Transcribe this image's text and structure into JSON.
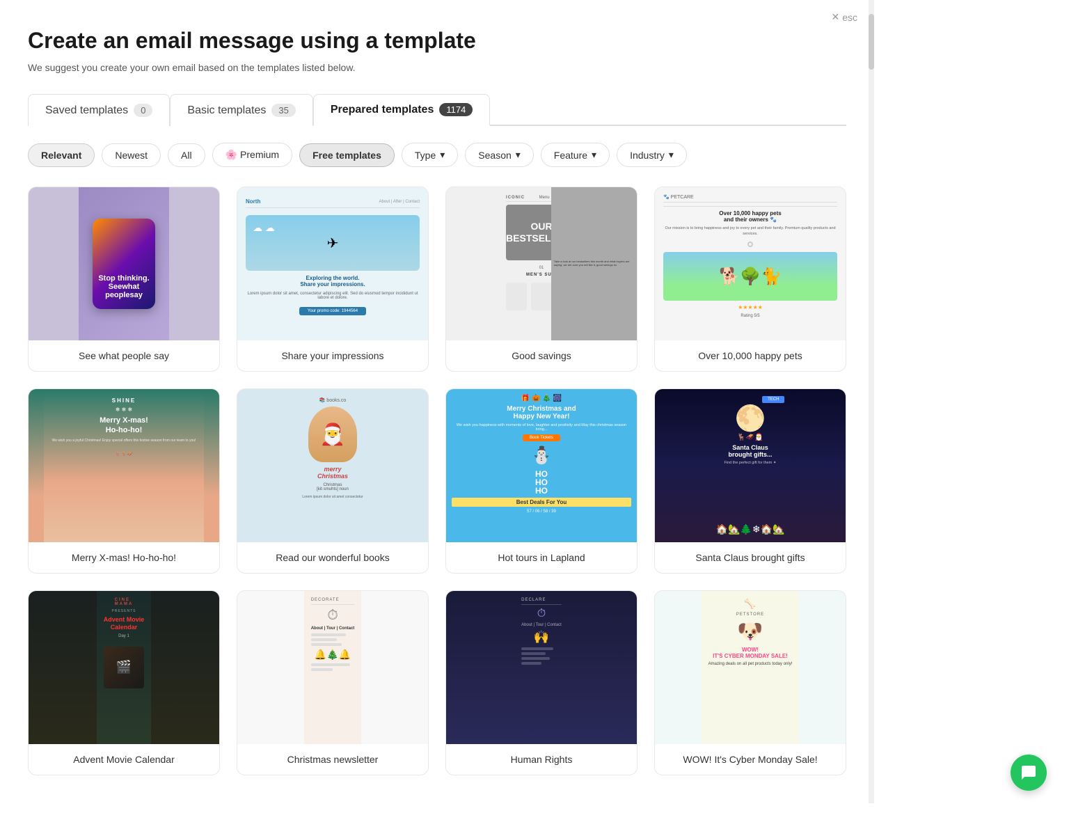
{
  "header": {
    "title": "Create an email message using a template",
    "subtitle": "We suggest you create your own email based on the templates listed below.",
    "esc_label": "esc"
  },
  "tabs": [
    {
      "id": "saved",
      "label": "Saved templates",
      "count": "0",
      "active": false
    },
    {
      "id": "basic",
      "label": "Basic templates",
      "count": "35",
      "active": false
    },
    {
      "id": "prepared",
      "label": "Prepared templates",
      "count": "1174",
      "active": true
    }
  ],
  "filters": [
    {
      "id": "relevant",
      "label": "Relevant",
      "active": true,
      "hasDropdown": false,
      "hasPremium": false
    },
    {
      "id": "newest",
      "label": "Newest",
      "active": false,
      "hasDropdown": false,
      "hasPremium": false
    },
    {
      "id": "all",
      "label": "All",
      "active": false,
      "hasDropdown": false,
      "hasPremium": false
    },
    {
      "id": "premium",
      "label": "Premium",
      "active": false,
      "hasDropdown": false,
      "hasPremium": true
    },
    {
      "id": "free",
      "label": "Free templates",
      "active": true,
      "hasDropdown": false,
      "hasPremium": false
    },
    {
      "id": "type",
      "label": "Type",
      "active": false,
      "hasDropdown": true,
      "hasPremium": false
    },
    {
      "id": "season",
      "label": "Season",
      "active": false,
      "hasDropdown": true,
      "hasPremium": false
    },
    {
      "id": "feature",
      "label": "Feature",
      "active": false,
      "hasDropdown": true,
      "hasPremium": false
    },
    {
      "id": "industry",
      "label": "Industry",
      "active": false,
      "hasDropdown": true,
      "hasPremium": false
    }
  ],
  "templates": [
    {
      "id": 1,
      "label": "See what people say"
    },
    {
      "id": 2,
      "label": "Share your impressions"
    },
    {
      "id": 3,
      "label": "Good savings"
    },
    {
      "id": 4,
      "label": "Over 10,000 happy pets"
    },
    {
      "id": 5,
      "label": "Merry X-mas! Ho-ho-ho!"
    },
    {
      "id": 6,
      "label": "Read our wonderful books"
    },
    {
      "id": 7,
      "label": "Hot tours in Lapland"
    },
    {
      "id": 8,
      "label": "Santa Claus brought gifts"
    },
    {
      "id": 9,
      "label": "Advent Movie Calendar"
    },
    {
      "id": 10,
      "label": "Christmas newsletter"
    },
    {
      "id": 11,
      "label": "Human Rights"
    },
    {
      "id": 12,
      "label": "WOW! It's Cyber Monday Sale!"
    }
  ],
  "chat_button": {
    "label": "Chat"
  }
}
